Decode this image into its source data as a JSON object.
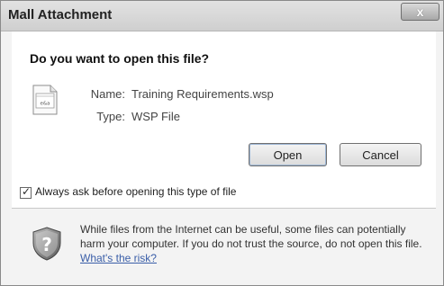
{
  "window": {
    "title": "Mall Attachment",
    "close_label": "x"
  },
  "dialog": {
    "heading": "Do you want to open this file?",
    "file": {
      "name_label": "Name:",
      "name_value": "Training Requirements.wsp",
      "type_label": "Type:",
      "type_value": "WSP File"
    },
    "buttons": {
      "open": "Open",
      "cancel": "Cancel"
    },
    "checkbox": {
      "label": "Always ask before opening this type of file",
      "checked": true
    },
    "warning": {
      "text": "While files from the Internet can be useful, some files can potentially harm your computer. If you do not trust the source, do not open this file.",
      "link": "What's the risk?"
    }
  },
  "icons": {
    "file": "document-icon",
    "shield": "security-shield-icon",
    "close": "close-icon"
  }
}
